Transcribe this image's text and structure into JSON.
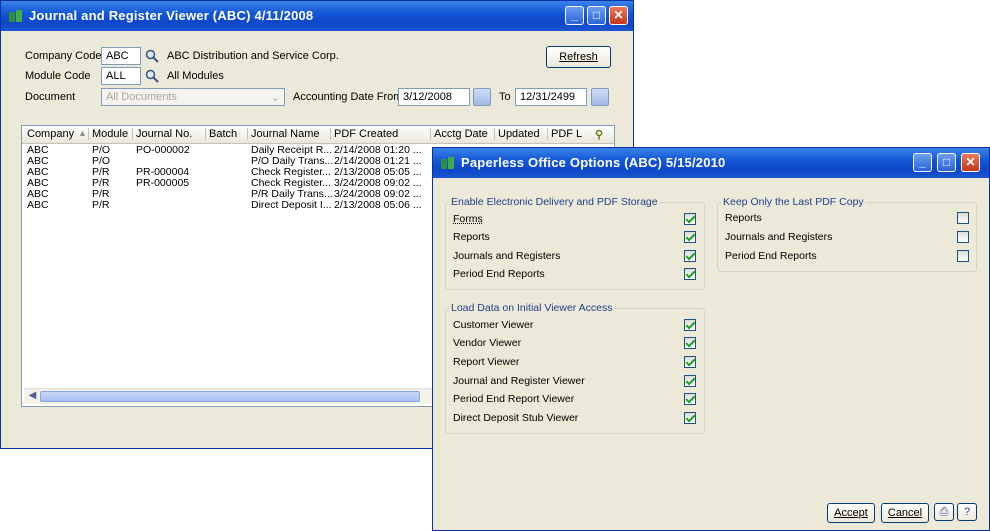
{
  "journal_window": {
    "title": "Journal and Register Viewer (ABC) 4/11/2008",
    "company_code_label": "Company Code",
    "company_code_value": "ABC",
    "company_name": "ABC Distribution and Service Corp.",
    "module_code_label": "Module Code",
    "module_code_value": "ALL",
    "module_name": "All Modules",
    "document_label": "Document",
    "document_value": "All Documents",
    "accounting_date_from_label": "Accounting Date From",
    "date_from": "3/12/2008",
    "to_label": "To",
    "date_to": "12/31/2499",
    "refresh_button": "Refresh",
    "columns": [
      "Company",
      "Module",
      "Journal No.",
      "Batch",
      "Journal Name",
      "PDF Created",
      "Acctg Date",
      "Updated",
      "PDF L"
    ],
    "rows": [
      [
        "ABC",
        "P/O",
        "PO-000002",
        "",
        "Daily Receipt R...",
        "2/14/2008 01:20 ..."
      ],
      [
        "ABC",
        "P/O",
        "",
        "",
        "P/O Daily Trans...",
        "2/14/2008 01:21 ..."
      ],
      [
        "ABC",
        "P/R",
        "PR-000004",
        "",
        "Check Register...",
        "2/13/2008 05:05 ..."
      ],
      [
        "ABC",
        "P/R",
        "PR-000005",
        "",
        "Check Register...",
        "3/24/2008 09:02 ..."
      ],
      [
        "ABC",
        "P/R",
        "",
        "",
        "P/R Daily Trans...",
        "3/24/2008 09:02 ..."
      ],
      [
        "ABC",
        "P/R",
        "",
        "",
        "Direct Deposit I...",
        "2/13/2008 05:06 ..."
      ]
    ]
  },
  "options_window": {
    "title": "Paperless Office Options (ABC) 5/15/2010",
    "group_delivery": {
      "title": "Enable Electronic Delivery and PDF Storage",
      "items": [
        {
          "label": "Forms",
          "checked": true
        },
        {
          "label": "Reports",
          "checked": true
        },
        {
          "label": "Journals and Registers",
          "checked": true
        },
        {
          "label": "Period End Reports",
          "checked": true
        }
      ]
    },
    "group_load": {
      "title": "Load Data on Initial Viewer Access",
      "items": [
        {
          "label": "Customer Viewer",
          "checked": true
        },
        {
          "label": "Vendor Viewer",
          "checked": true
        },
        {
          "label": "Report Viewer",
          "checked": true
        },
        {
          "label": "Journal and Register Viewer",
          "checked": true
        },
        {
          "label": "Period End Report Viewer",
          "checked": true
        },
        {
          "label": "Direct Deposit Stub Viewer",
          "checked": true
        }
      ]
    },
    "group_keep": {
      "title": "Keep Only the Last PDF Copy",
      "items": [
        {
          "label": "Reports",
          "checked": false
        },
        {
          "label": "Journals and Registers",
          "checked": false
        },
        {
          "label": "Period End Reports",
          "checked": false
        }
      ]
    },
    "accept_button": "Accept",
    "cancel_button": "Cancel"
  },
  "colors": {
    "titlebar": "#1558d6",
    "window_face": "#ece9d8",
    "group_title": "#1f3f8f",
    "check": "#21a121"
  }
}
